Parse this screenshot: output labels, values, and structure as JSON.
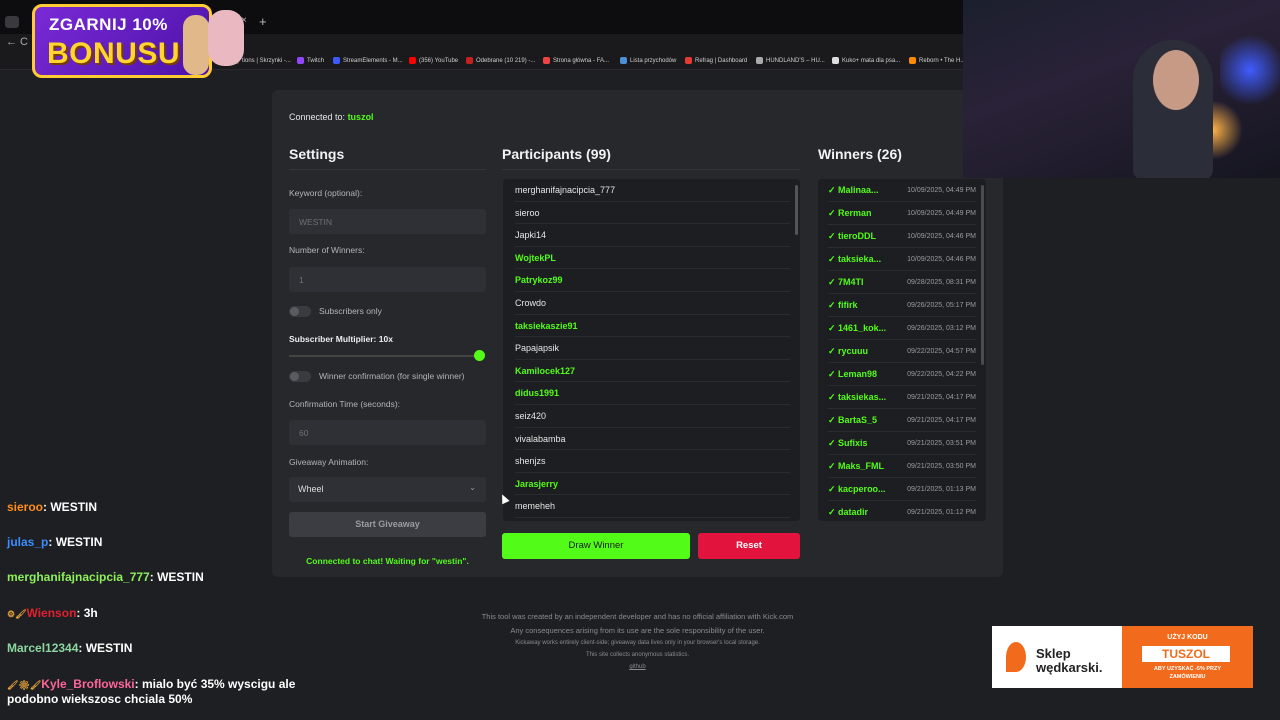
{
  "browser": {
    "tab_close": "×",
    "tab_new": "+",
    "nav": "←   C",
    "bookmarks": [
      {
        "label": "tions | Skrzynki -...",
        "color": "#555"
      },
      {
        "label": "Twitch",
        "color": "#9146ff"
      },
      {
        "label": "StreamElements - M...",
        "color": "#3d5afe"
      },
      {
        "label": "(356) YouTube",
        "color": "#ff0000"
      },
      {
        "label": "Odebrane (10 219) -...",
        "color": "#c5221f"
      },
      {
        "label": "Strona główna - FA...",
        "color": "#e44"
      },
      {
        "label": "Lista przychodów",
        "color": "#4a90d9"
      },
      {
        "label": "Refrag | Dashboard",
        "color": "#e53935"
      },
      {
        "label": "HUNDLAND'S – HU...",
        "color": "#aaa"
      },
      {
        "label": "Kuko+ mata dla psa...",
        "color": "#ddd"
      },
      {
        "label": "Reborn • The H...",
        "color": "#ff8a00"
      }
    ]
  },
  "bonus": {
    "line1": "ZGARNIJ 10%",
    "line2": "BONUSU"
  },
  "app": {
    "connected_prefix": "Connected to:",
    "channel": "tuszol",
    "settings": {
      "title": "Settings",
      "keyword_label": "Keyword (optional):",
      "keyword_placeholder": "WESTIN",
      "winners_label": "Number of Winners:",
      "winners_placeholder": "1",
      "subscribers_only": "Subscribers only",
      "multiplier": "Subscriber Multiplier: 10x",
      "multiplier_value": 10,
      "winner_confirmation": "Winner confirmation (for single winner)",
      "confirm_time_label": "Confirmation Time (seconds):",
      "confirm_time_placeholder": "60",
      "animation_label": "Giveaway Animation:",
      "animation_value": "Wheel",
      "chevron": "⌄",
      "start_button": "Start Giveaway",
      "status": "Connected to chat! Waiting for \"westin\"."
    },
    "participants": {
      "title": "Participants (99)",
      "rows": [
        {
          "name": "merghanifajnacipcia_777",
          "sub": false
        },
        {
          "name": "sieroo",
          "sub": false
        },
        {
          "name": "Japki14",
          "sub": false
        },
        {
          "name": "WojtekPL",
          "sub": true
        },
        {
          "name": "Patrykoz99",
          "sub": true
        },
        {
          "name": "Crowdo",
          "sub": false
        },
        {
          "name": "taksiekaszie91",
          "sub": true
        },
        {
          "name": "Papajapsik",
          "sub": false
        },
        {
          "name": "Kamilocek127",
          "sub": true
        },
        {
          "name": "didus1991",
          "sub": true
        },
        {
          "name": "seiz420",
          "sub": false
        },
        {
          "name": "vivalabamba",
          "sub": false
        },
        {
          "name": "shenjzs",
          "sub": false
        },
        {
          "name": "Jarasjerry",
          "sub": true
        },
        {
          "name": "memeheh",
          "sub": false
        }
      ]
    },
    "draw_button": "Draw Winner",
    "reset_button": "Reset",
    "winners": {
      "title": "Winners (26)",
      "rows": [
        {
          "name": "✓ Malinaa...",
          "date": "10/09/2025, 04:49 PM"
        },
        {
          "name": "✓ Rerman",
          "date": "10/09/2025, 04:49 PM"
        },
        {
          "name": "✓ tieroDDL",
          "date": "10/09/2025, 04:46 PM"
        },
        {
          "name": "✓ taksieka...",
          "date": "10/09/2025, 04:46 PM"
        },
        {
          "name": "✓ 7M4TI",
          "date": "09/28/2025, 08:31 PM"
        },
        {
          "name": "✓ fifirk",
          "date": "09/26/2025, 05:17 PM"
        },
        {
          "name": "✓ 1461_kok...",
          "date": "09/26/2025, 03:12 PM"
        },
        {
          "name": "✓ rycuuu",
          "date": "09/22/2025, 04:57 PM"
        },
        {
          "name": "✓ Leman98",
          "date": "09/22/2025, 04:22 PM"
        },
        {
          "name": "✓ taksiekas...",
          "date": "09/21/2025, 04:17 PM"
        },
        {
          "name": "✓ BartaS_5",
          "date": "09/21/2025, 04:17 PM"
        },
        {
          "name": "✓ Sufixis",
          "date": "09/21/2025, 03:51 PM"
        },
        {
          "name": "✓ Maks_FML",
          "date": "09/21/2025, 03:50 PM"
        },
        {
          "name": "✓ kacperoo...",
          "date": "09/21/2025, 01:13 PM"
        },
        {
          "name": "✓ datadir",
          "date": "09/21/2025, 01:12 PM"
        }
      ]
    }
  },
  "footer": {
    "line1": "This tool was created by an independent developer and has no official affiliation with Kick.com",
    "line2": "Any consequences arising from its use are the sole responsibility of the user.",
    "line3": "Kickaway works entirely client-side; giveaway data lives only in your browser's local storage.",
    "line4": "This site collects anonymous statistics.",
    "line5": "github"
  },
  "chat": [
    {
      "badge": "",
      "name": "sieroo",
      "color": "#ff8c1a",
      "msg": "WESTIN"
    },
    {
      "badge": "",
      "name": "julas_p",
      "color": "#3b8cff",
      "msg": "WESTIN"
    },
    {
      "badge": "",
      "name": "merghanifajnacipcia_777",
      "color": "#8cf05a",
      "msg": "WESTIN"
    },
    {
      "badge": "⚙🖌",
      "name": "Wienson",
      "color": "#e0202e",
      "msg": "3h"
    },
    {
      "badge": "",
      "name": "Marcel12344",
      "color": "#8cd6a0",
      "msg": "WESTIN"
    },
    {
      "badge": "🖌⚙🖌",
      "name": "Kyle_Broflowski",
      "color": "#ff6699",
      "msg": "mialo być 35% wyscigu ale"
    },
    {
      "badge": "",
      "name": "",
      "color": "#ffffff",
      "msg": "podobno wiekszosc chciala 50%"
    }
  ],
  "ad": {
    "brand1": "Sklep",
    "brand2": "wędkarski.",
    "line1": "UŻYJ KODU",
    "code": "TUSZOL",
    "line2": "ABY UZYSKAĆ -5% PRZY",
    "line3": "ZAMÓWIENIU"
  }
}
